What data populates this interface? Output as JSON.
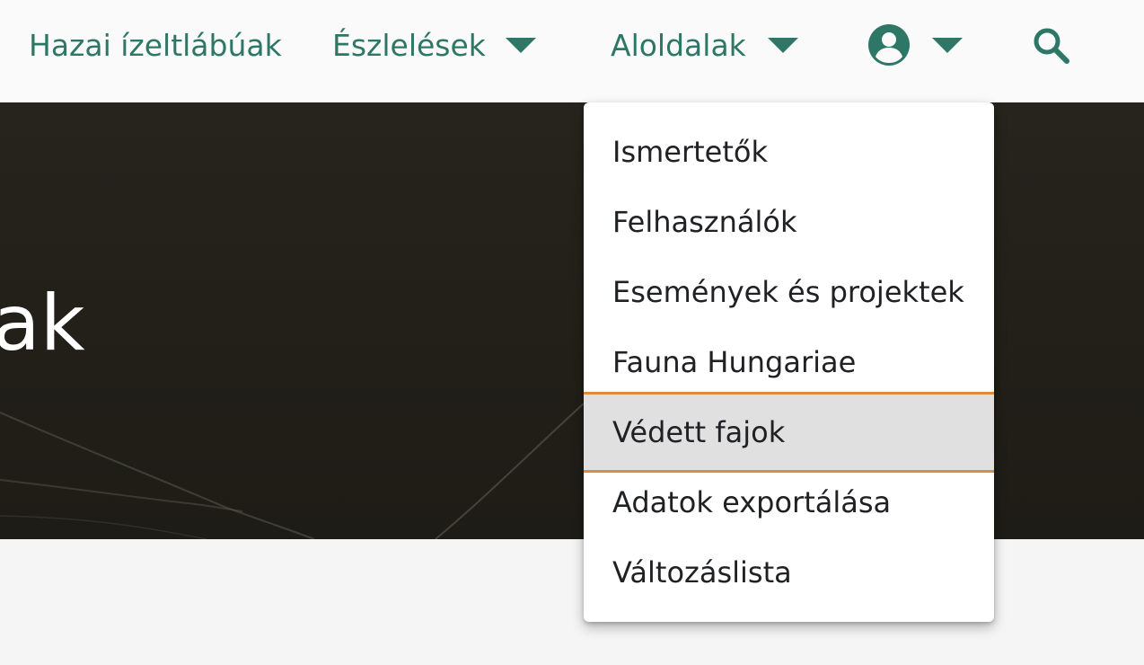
{
  "nav": {
    "items": [
      {
        "label": "Hazai ízeltlábúak"
      },
      {
        "label": "Észlelések"
      },
      {
        "label": "Aloldalak"
      }
    ],
    "account_icon": "account-circle-icon",
    "search_icon": "search-icon"
  },
  "hero": {
    "title_fragment": "ak"
  },
  "dropdown": {
    "items": [
      {
        "label": "Ismertetők"
      },
      {
        "label": "Felhasználók"
      },
      {
        "label": "Események és projektek"
      },
      {
        "label": "Fauna Hungariae"
      },
      {
        "label": "Védett fajok"
      },
      {
        "label": "Adatok exportálása"
      },
      {
        "label": "Változáslista"
      }
    ],
    "active_label": "Védett fajok"
  },
  "colors": {
    "accent_green": "#2e7766",
    "highlight_orange": "#e08a3c",
    "hero_background": "#221f19"
  }
}
